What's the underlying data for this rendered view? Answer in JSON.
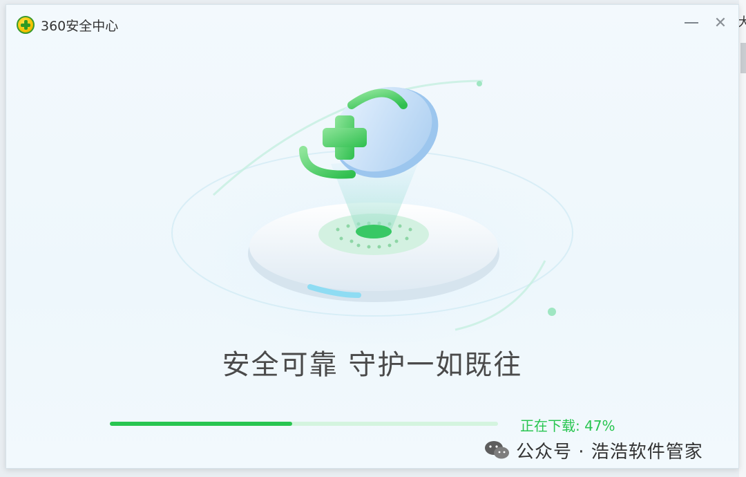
{
  "window": {
    "title": "360安全中心",
    "min_symbol": "—",
    "close_symbol": "✕"
  },
  "backdrop": {
    "char": "大"
  },
  "main": {
    "slogan": "安全可靠  守护一如既往"
  },
  "download": {
    "label": "正在下载: 47%",
    "progress": 0.47
  },
  "watermark": {
    "text": "公众号 · 浩浩软件管家"
  },
  "icons": {
    "logo": "360-logo-icon",
    "minimize": "minimize-icon",
    "close": "close-icon",
    "hero": "shield-plus-icon",
    "watermark": "wechat-icon"
  },
  "colors": {
    "accent": "#29c551",
    "track": "#d4f4df",
    "text": "#4a4a4a"
  }
}
